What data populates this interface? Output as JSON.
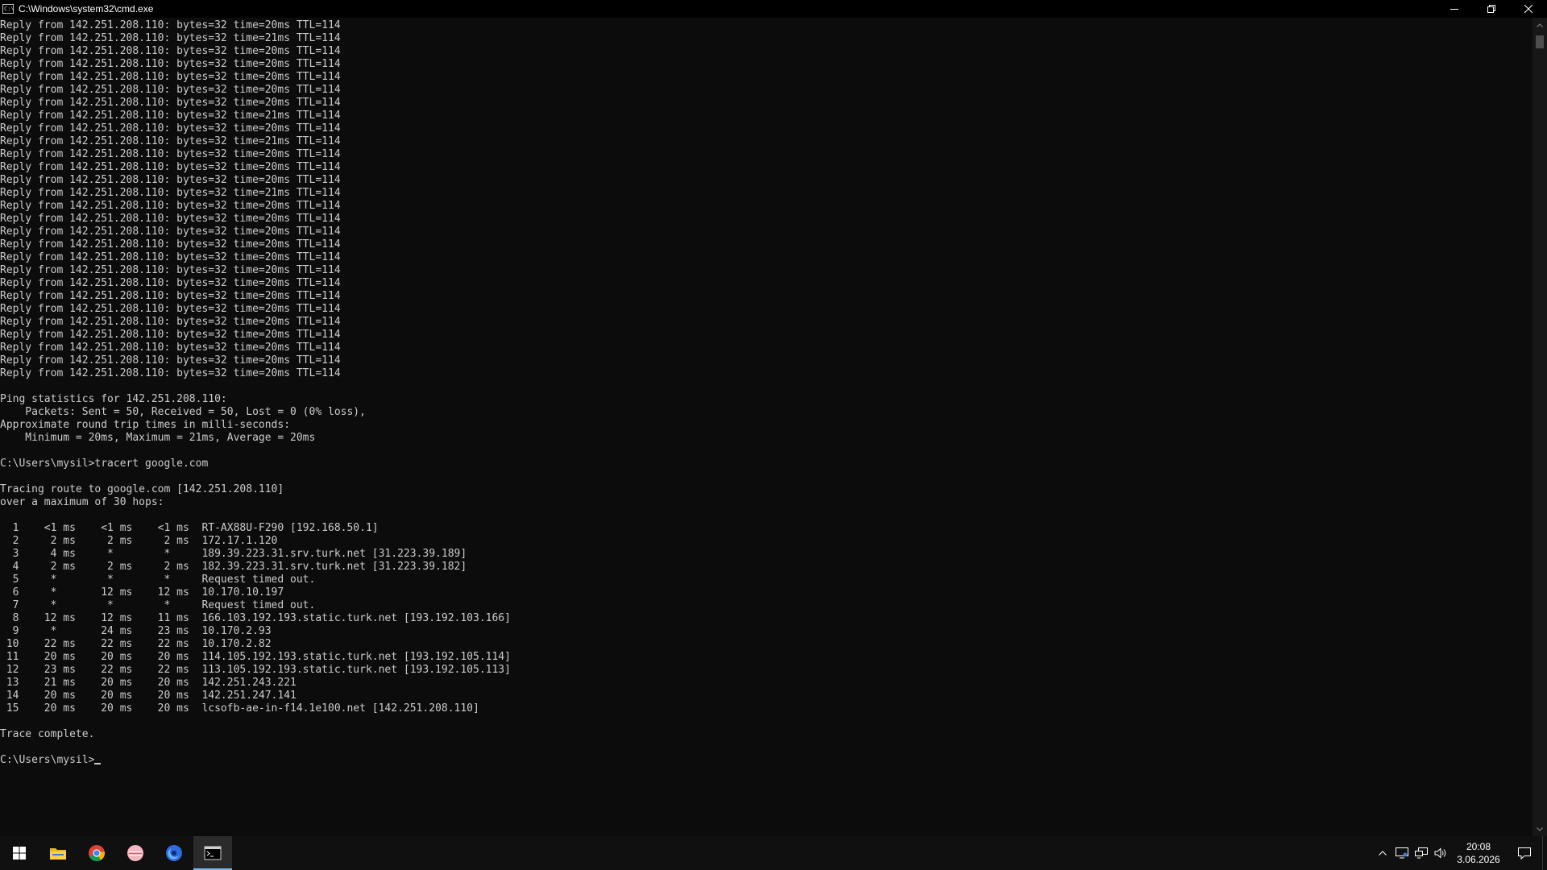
{
  "window": {
    "title": "C:\\Windows\\system32\\cmd.exe",
    "icon_text": "C:\\"
  },
  "console": {
    "lines": [
      "Reply from 142.251.208.110: bytes=32 time=20ms TTL=114",
      "Reply from 142.251.208.110: bytes=32 time=21ms TTL=114",
      "Reply from 142.251.208.110: bytes=32 time=20ms TTL=114",
      "Reply from 142.251.208.110: bytes=32 time=20ms TTL=114",
      "Reply from 142.251.208.110: bytes=32 time=20ms TTL=114",
      "Reply from 142.251.208.110: bytes=32 time=20ms TTL=114",
      "Reply from 142.251.208.110: bytes=32 time=20ms TTL=114",
      "Reply from 142.251.208.110: bytes=32 time=21ms TTL=114",
      "Reply from 142.251.208.110: bytes=32 time=20ms TTL=114",
      "Reply from 142.251.208.110: bytes=32 time=21ms TTL=114",
      "Reply from 142.251.208.110: bytes=32 time=20ms TTL=114",
      "Reply from 142.251.208.110: bytes=32 time=20ms TTL=114",
      "Reply from 142.251.208.110: bytes=32 time=20ms TTL=114",
      "Reply from 142.251.208.110: bytes=32 time=21ms TTL=114",
      "Reply from 142.251.208.110: bytes=32 time=20ms TTL=114",
      "Reply from 142.251.208.110: bytes=32 time=20ms TTL=114",
      "Reply from 142.251.208.110: bytes=32 time=20ms TTL=114",
      "Reply from 142.251.208.110: bytes=32 time=20ms TTL=114",
      "Reply from 142.251.208.110: bytes=32 time=20ms TTL=114",
      "Reply from 142.251.208.110: bytes=32 time=20ms TTL=114",
      "Reply from 142.251.208.110: bytes=32 time=20ms TTL=114",
      "Reply from 142.251.208.110: bytes=32 time=20ms TTL=114",
      "Reply from 142.251.208.110: bytes=32 time=20ms TTL=114",
      "Reply from 142.251.208.110: bytes=32 time=20ms TTL=114",
      "Reply from 142.251.208.110: bytes=32 time=20ms TTL=114",
      "Reply from 142.251.208.110: bytes=32 time=20ms TTL=114",
      "Reply from 142.251.208.110: bytes=32 time=20ms TTL=114",
      "Reply from 142.251.208.110: bytes=32 time=20ms TTL=114",
      "",
      "Ping statistics for 142.251.208.110:",
      "    Packets: Sent = 50, Received = 50, Lost = 0 (0% loss),",
      "Approximate round trip times in milli-seconds:",
      "    Minimum = 20ms, Maximum = 21ms, Average = 20ms",
      "",
      "C:\\Users\\mysil>tracert google.com",
      "",
      "Tracing route to google.com [142.251.208.110]",
      "over a maximum of 30 hops:",
      "",
      "  1    <1 ms    <1 ms    <1 ms  RT-AX88U-F290 [192.168.50.1]",
      "  2     2 ms     2 ms     2 ms  172.17.1.120",
      "  3     4 ms     *        *     189.39.223.31.srv.turk.net [31.223.39.189]",
      "  4     2 ms     2 ms     2 ms  182.39.223.31.srv.turk.net [31.223.39.182]",
      "  5     *        *        *     Request timed out.",
      "  6     *       12 ms    12 ms  10.170.10.197",
      "  7     *        *        *     Request timed out.",
      "  8    12 ms    12 ms    11 ms  166.103.192.193.static.turk.net [193.192.103.166]",
      "  9     *       24 ms    23 ms  10.170.2.93",
      " 10    22 ms    22 ms    22 ms  10.170.2.82",
      " 11    20 ms    20 ms    20 ms  114.105.192.193.static.turk.net [193.192.105.114]",
      " 12    23 ms    22 ms    22 ms  113.105.192.193.static.turk.net [193.192.105.113]",
      " 13    21 ms    20 ms    20 ms  142.251.243.221",
      " 14    20 ms    20 ms    20 ms  142.251.247.141",
      " 15    20 ms    20 ms    20 ms  lcsofb-ae-in-f14.1e100.net [142.251.208.110]",
      "",
      "Trace complete.",
      ""
    ],
    "prompt": "C:\\Users\\mysil>"
  },
  "taskbar": {
    "items": [
      {
        "name": "start-button",
        "icon": "windows-logo-icon"
      },
      {
        "name": "file-explorer",
        "icon": "folder-icon"
      },
      {
        "name": "chrome",
        "icon": "chrome-icon"
      },
      {
        "name": "app-pink",
        "icon": "app-icon"
      },
      {
        "name": "app-blue",
        "icon": "app-icon"
      },
      {
        "name": "cmd",
        "icon": "terminal-icon",
        "active": true
      }
    ],
    "clock": {
      "time": "20:08",
      "date": "3.06.2026"
    }
  },
  "colors": {
    "console_bg": "#0c0c0c",
    "console_fg": "#cccccc",
    "titlebar_bg": "#000000",
    "taskbar_bg": "#101010",
    "accent": "#76b9ed"
  }
}
